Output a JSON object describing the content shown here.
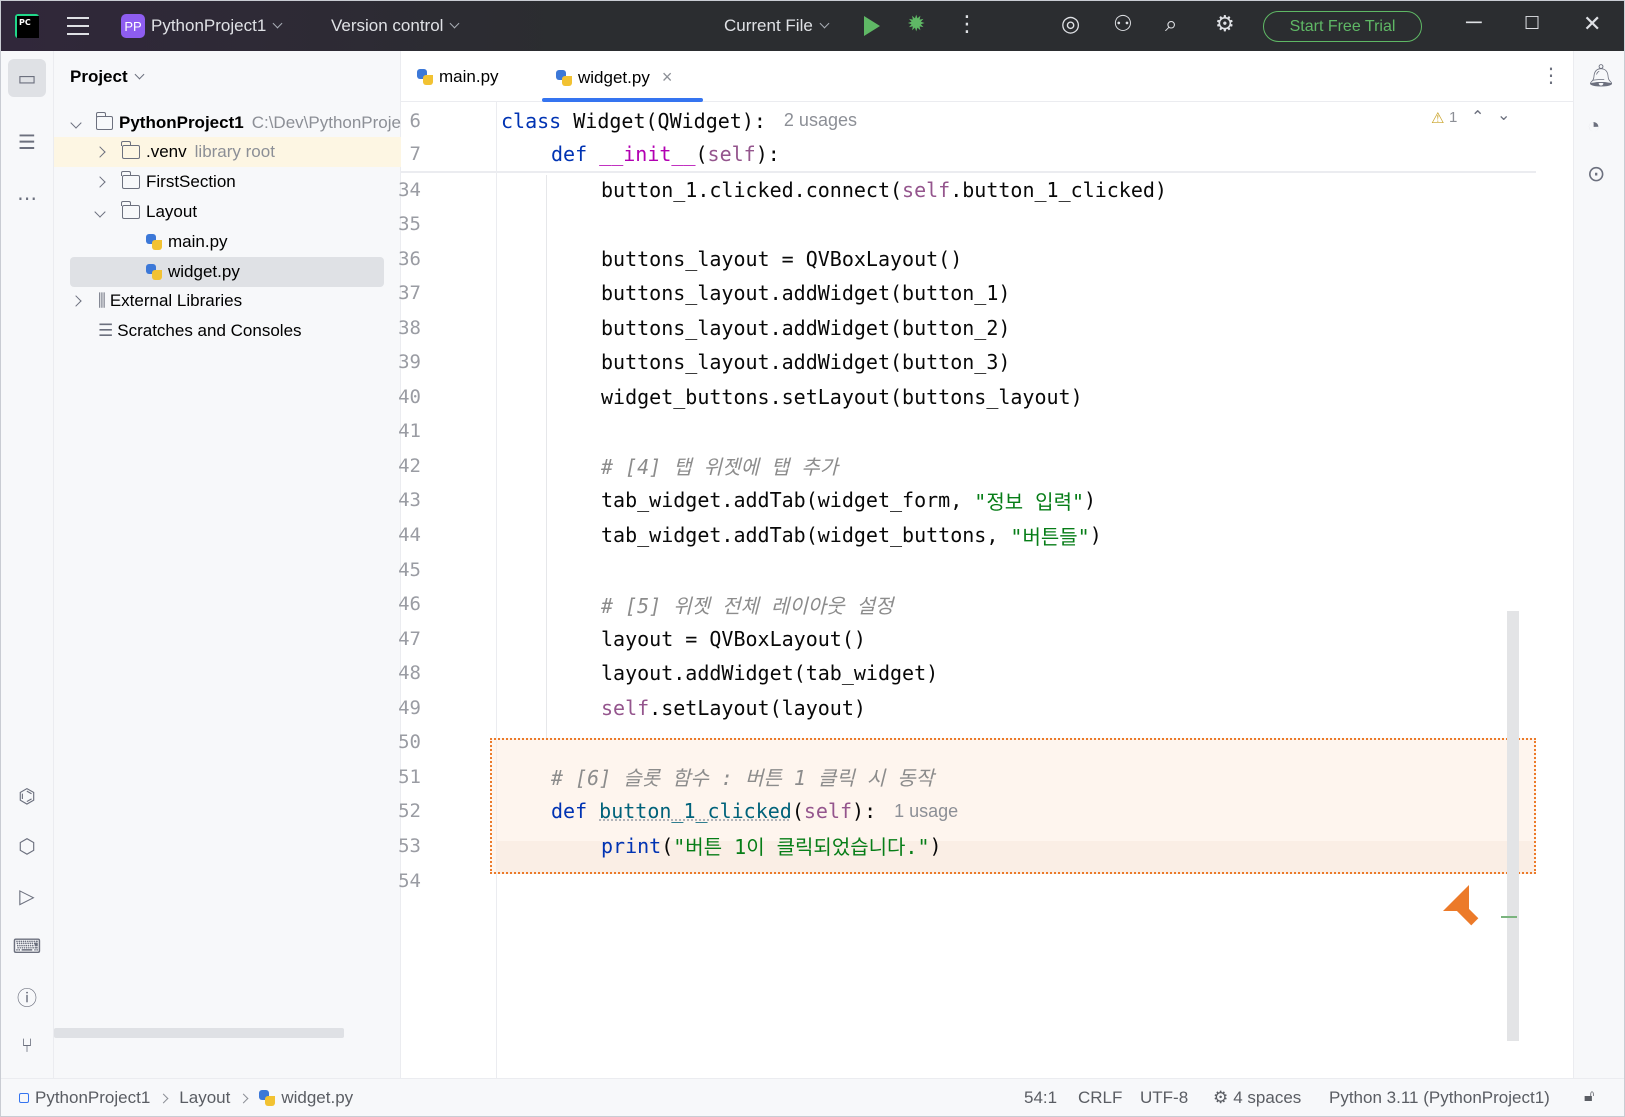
{
  "titlebar": {
    "project_badge": "PP",
    "project_name": "PythonProject1",
    "version_control": "Version control",
    "run_config": "Current File",
    "trial_button": "Start Free Trial"
  },
  "project_panel": {
    "title": "Project",
    "root_name": "PythonProject1",
    "root_path": "C:\\Dev\\PythonProje",
    "items": [
      {
        "label": ".venv",
        "extra": "library root"
      },
      {
        "label": "FirstSection",
        "extra": ""
      },
      {
        "label": "Layout",
        "extra": ""
      },
      {
        "label": "main.py",
        "extra": ""
      },
      {
        "label": "widget.py",
        "extra": ""
      },
      {
        "label": "External Libraries",
        "extra": ""
      },
      {
        "label": "Scratches and Consoles",
        "extra": ""
      }
    ]
  },
  "tabs": [
    {
      "label": "main.py"
    },
    {
      "label": "widget.py"
    }
  ],
  "editor": {
    "warning_count": "1",
    "sticky": [
      {
        "num": "6",
        "kw": "class",
        "rest": " Widget(QWidget):",
        "hint": "2 usages"
      },
      {
        "num": "7",
        "kw": "def",
        "dunder": "__init__",
        "open": "(",
        "self": "self",
        "close": "):"
      }
    ],
    "lines": [
      {
        "num": "34",
        "text": "button_1.clicked.connect(",
        "self": "self",
        "tail": ".button_1_clicked)"
      },
      {
        "num": "35"
      },
      {
        "num": "36",
        "text": "buttons_layout = QVBoxLayout()"
      },
      {
        "num": "37",
        "text": "buttons_layout.addWidget(button_1)"
      },
      {
        "num": "38",
        "text": "buttons_layout.addWidget(button_2)"
      },
      {
        "num": "39",
        "text": "buttons_layout.addWidget(button_3)"
      },
      {
        "num": "40",
        "text": "widget_buttons.setLayout(buttons_layout)"
      },
      {
        "num": "41"
      },
      {
        "num": "42",
        "comment": "# [4] 탭 위젯에 탭 추가"
      },
      {
        "num": "43",
        "text": "tab_widget.addTab(widget_form, ",
        "str": "\"정보 입력\"",
        "tail": ")"
      },
      {
        "num": "44",
        "text": "tab_widget.addTab(widget_buttons, ",
        "str": "\"버튼들\"",
        "tail": ")"
      },
      {
        "num": "45"
      },
      {
        "num": "46",
        "comment": "# [5] 위젯 전체 레이아웃 설정"
      },
      {
        "num": "47",
        "text": "layout = QVBoxLayout()"
      },
      {
        "num": "48",
        "text": "layout.addWidget(tab_widget)"
      },
      {
        "num": "49",
        "self": "self",
        "tail": ".setLayout(layout)"
      },
      {
        "num": "50"
      },
      {
        "num": "51",
        "comment": "# [6] 슬롯 함수 : 버튼 1 클릭 시 동작"
      },
      {
        "num": "52",
        "kw": "def",
        "fn": "button_1_clicked",
        "open": "(",
        "self": "self",
        "close": "):",
        "hint": "1 usage"
      },
      {
        "num": "53",
        "builtin": "print",
        "open": "(",
        "str": "\"버튼 1이 클릭되었습니다.\"",
        "close": ")"
      },
      {
        "num": "54"
      }
    ]
  },
  "statusbar": {
    "crumbs": [
      "PythonProject1",
      "Layout",
      "widget.py"
    ],
    "position": "54:1",
    "line_sep": "CRLF",
    "encoding": "UTF-8",
    "indent": "4 spaces",
    "interpreter": "Python 3.11 (PythonProject1)"
  },
  "colors": {
    "accent": "#3574f0",
    "highlight_border": "#ec7a29",
    "trial_green": "#5fb865"
  },
  "icons": [
    "pycharm-logo-icon",
    "hamburger-menu-icon",
    "run-icon",
    "debug-icon",
    "more-icon",
    "ai-spiral-icon",
    "add-user-icon",
    "search-icon",
    "gear-icon",
    "minimize-icon",
    "maximize-icon",
    "close-icon",
    "folder-icon",
    "structure-icon",
    "python-console-icon",
    "python-packages-icon",
    "services-icon",
    "terminal-icon",
    "problems-icon",
    "git-icon",
    "notifications-icon",
    "ai-chat-icon",
    "copilot-icon",
    "lock-icon"
  ]
}
